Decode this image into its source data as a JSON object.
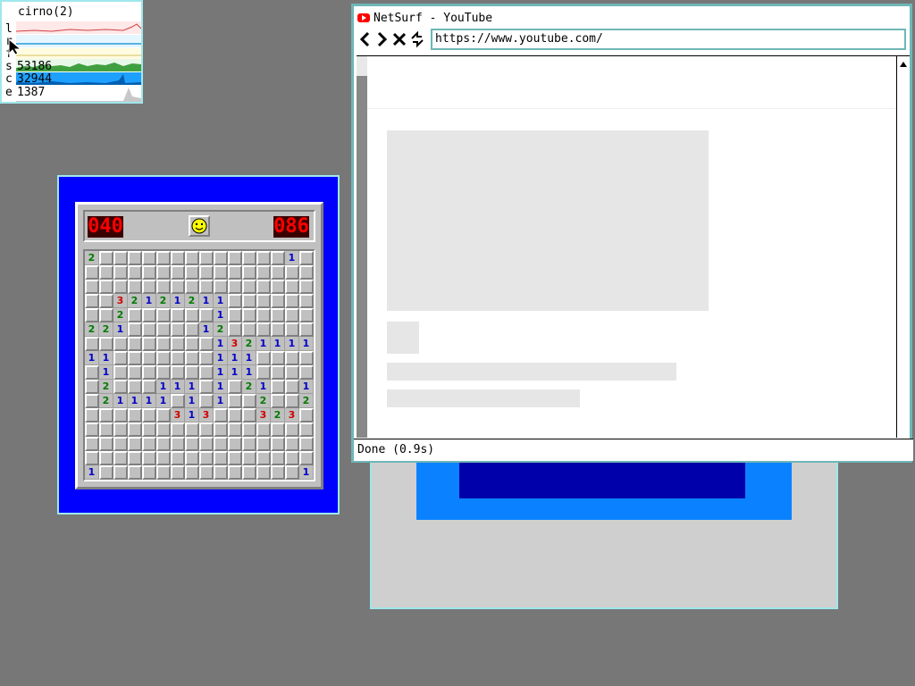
{
  "stats": {
    "title": "cirno(2)",
    "rows": [
      {
        "label": "l",
        "value": ""
      },
      {
        "label": "r",
        "value": ""
      },
      {
        "label": "f",
        "value": ""
      },
      {
        "label": "s",
        "value": "53186"
      },
      {
        "label": "c",
        "value": "32944"
      },
      {
        "label": "e",
        "value": "1387"
      }
    ]
  },
  "minesweeper": {
    "mines_counter": "040",
    "timer": "086",
    "smiley": "smiley-face",
    "board": [
      "2.............1",
      "................",
      "................",
      "..32121211......",
      "..2......1......",
      "221.....12......",
      ".........13211111",
      "11.......111....",
      ".1.......111....",
      ".2...111.1.21..11",
      ".21111.1.1..2..2.",
      "......313...323.",
      "................",
      "................",
      "................",
      "1..............1"
    ]
  },
  "netsurf": {
    "window_title": "NetSurf - YouTube",
    "url": "https://www.youtube.com/",
    "status": "Done (0.9s)",
    "nav": {
      "back": "<",
      "forward": ">",
      "stop": "✕",
      "reload": "↻"
    }
  },
  "colors": {
    "desktop": "#777777",
    "border_accent": "#9fe7ec",
    "minesweeper_bg": "#0000ff",
    "youtube_red": "#ff0000"
  }
}
